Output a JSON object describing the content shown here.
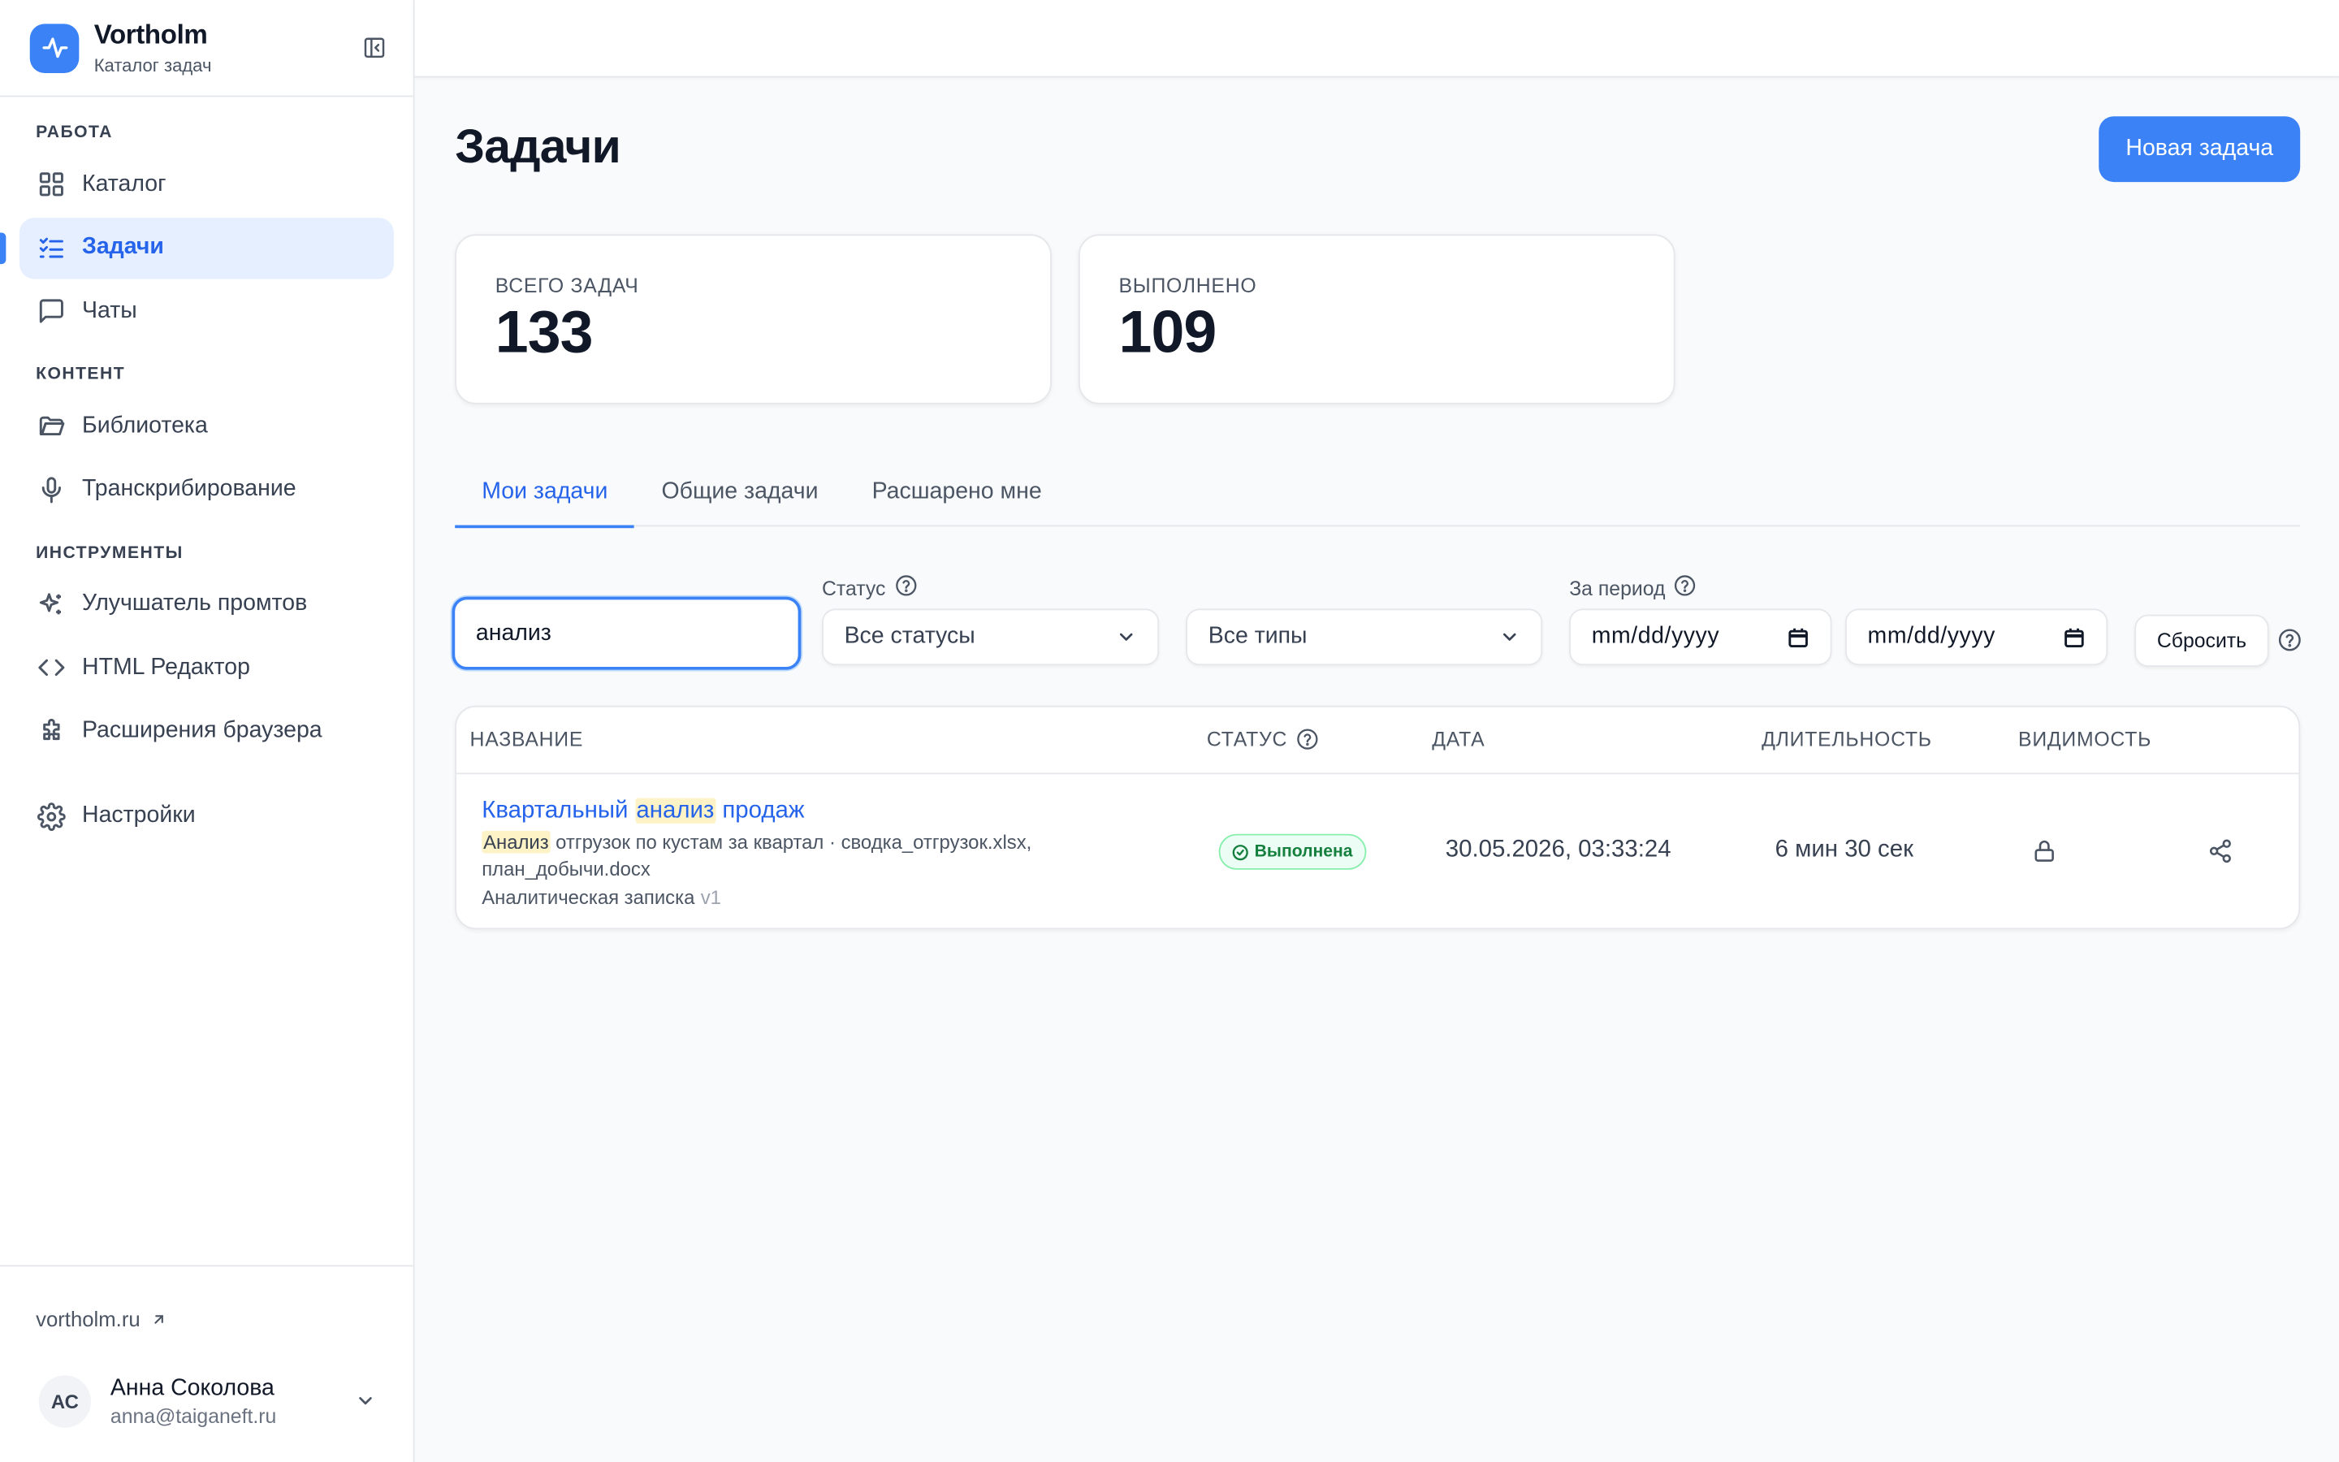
{
  "brand": {
    "name": "Vortholm",
    "subtitle": "Каталог задач",
    "accent": "#3b82f6"
  },
  "sidebar": {
    "sections": [
      {
        "title": "РАБОТА",
        "items": [
          {
            "label": "Каталог",
            "icon": "grid-icon"
          },
          {
            "label": "Задачи",
            "icon": "checklist-icon",
            "active": true
          },
          {
            "label": "Чаты",
            "icon": "chat-icon"
          }
        ]
      },
      {
        "title": "КОНТЕНТ",
        "items": [
          {
            "label": "Библиотека",
            "icon": "folder-icon"
          },
          {
            "label": "Транскрибирование",
            "icon": "microphone-icon"
          }
        ]
      },
      {
        "title": "ИНСТРУМЕНТЫ",
        "items": [
          {
            "label": "Улучшатель промтов",
            "icon": "sparkles-icon"
          },
          {
            "label": "HTML Редактор",
            "icon": "code-icon"
          },
          {
            "label": "Расширения браузера",
            "icon": "puzzle-icon"
          }
        ]
      }
    ],
    "settings_label": "Настройки",
    "site_link": "vortholm.ru",
    "user": {
      "initials": "АС",
      "name": "Анна Соколова",
      "email": "anna@taiganeft.ru"
    }
  },
  "main": {
    "title": "Задачи",
    "new_task_label": "Новая задача",
    "stats": [
      {
        "label": "ВСЕГО ЗАДАЧ",
        "value": "133"
      },
      {
        "label": "ВЫПОЛНЕНО",
        "value": "109"
      }
    ],
    "tabs": [
      {
        "label": "Мои задачи",
        "active": true
      },
      {
        "label": "Общие задачи"
      },
      {
        "label": "Расшарено мне"
      }
    ],
    "filters": {
      "search_value": "анализ",
      "status_label": "Статус",
      "status_value": "Все статусы",
      "type_value": "Все типы",
      "period_label": "За период",
      "date_from": "mm/dd/yyyy",
      "date_to": "mm/dd/yyyy",
      "reset_label": "Сбросить"
    },
    "table": {
      "headers": {
        "name": "НАЗВАНИЕ",
        "status": "СТАТУС",
        "date": "ДАТА",
        "duration": "ДЛИТЕЛЬНОСТЬ",
        "visibility": "ВИДИМОСТЬ"
      },
      "rows": [
        {
          "title_before": "Квартальный ",
          "title_match": "анализ",
          "title_after": " продаж",
          "desc_match": "Анализ",
          "desc_rest": " отгрузок по кустам за квартал · сводка_отгрузок.xlsx, план_добычи.docx",
          "type": "Аналитическая записка",
          "version": "v1",
          "status": "Выполнена",
          "status_color": "#15803d",
          "date": "30.05.2026, 03:33:24",
          "duration": "6 мин 30 сек",
          "visibility_icon": "lock-icon",
          "action_icon": "share-icon"
        }
      ]
    }
  }
}
